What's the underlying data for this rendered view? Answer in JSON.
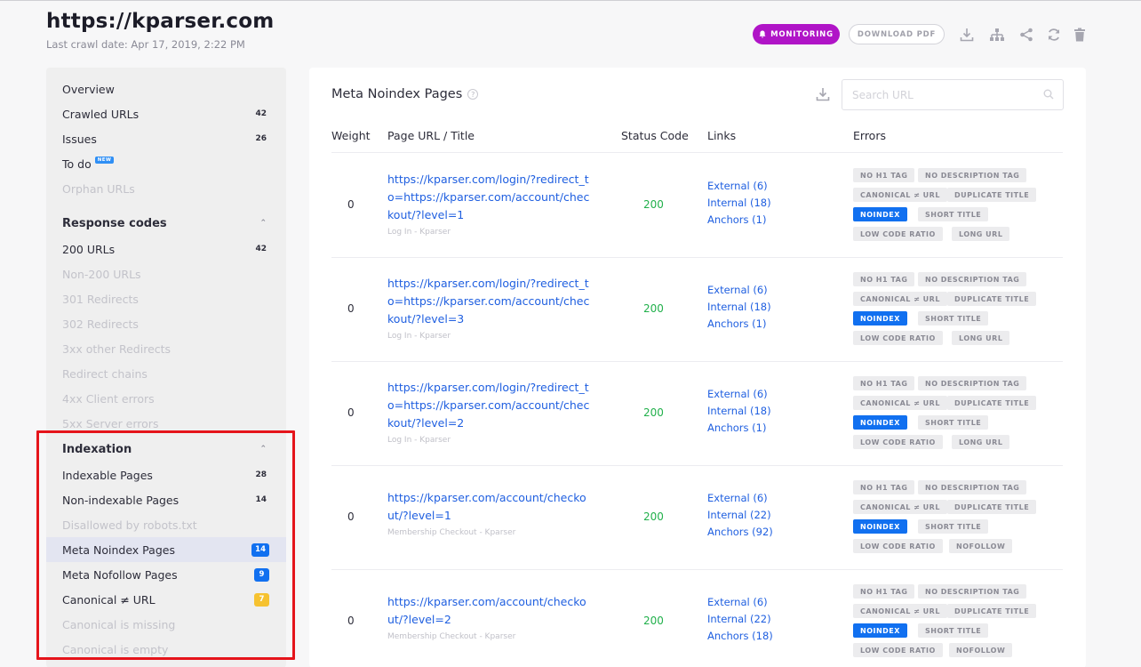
{
  "header": {
    "site_title": "https://kparser.com",
    "crawl_date": "Last crawl date: Apr 17, 2019, 2:22 PM",
    "monitoring_label": "MONITORING",
    "download_pdf_label": "DOWNLOAD PDF",
    "icons": [
      "download-icon",
      "sitemap-icon",
      "share-icon",
      "refresh-icon",
      "trash-icon"
    ]
  },
  "sidebar": {
    "top_items": [
      {
        "label": "Overview",
        "count": ""
      },
      {
        "label": "Crawled URLs",
        "count": "42"
      },
      {
        "label": "Issues",
        "count": "26"
      },
      {
        "label": "To do",
        "count": "",
        "badge": "NEW"
      },
      {
        "label": "Orphan URLs",
        "count": ""
      }
    ],
    "response_codes": {
      "header": "Response codes",
      "items": [
        {
          "label": "200 URLs",
          "count": "42"
        },
        {
          "label": "Non-200 URLs",
          "count": ""
        },
        {
          "label": "301 Redirects",
          "count": ""
        },
        {
          "label": "302 Redirects",
          "count": ""
        },
        {
          "label": "3xx other Redirects",
          "count": ""
        },
        {
          "label": "Redirect chains",
          "count": ""
        },
        {
          "label": "4xx Client errors",
          "count": ""
        },
        {
          "label": "5xx Server errors",
          "count": ""
        }
      ]
    },
    "indexation": {
      "header": "Indexation",
      "items": [
        {
          "label": "Indexable Pages",
          "count": "28"
        },
        {
          "label": "Non-indexable Pages",
          "count": "14"
        },
        {
          "label": "Disallowed by robots.txt",
          "count": ""
        },
        {
          "label": "Meta Noindex Pages",
          "count": "14"
        },
        {
          "label": "Meta Nofollow Pages",
          "count": "9"
        },
        {
          "label": "Canonical ≠ URL",
          "count": "7"
        },
        {
          "label": "Canonical is missing",
          "count": ""
        },
        {
          "label": "Canonical is empty",
          "count": ""
        }
      ]
    }
  },
  "colors": {
    "monitoring": "#b014c7",
    "link": "#1f5fe0",
    "status_ok": "#21b04b",
    "badge_blue": "#1170f0",
    "badge_yellow": "#f6c230",
    "highlight": "#e5141b"
  },
  "main": {
    "title": "Meta Noindex Pages",
    "search_placeholder": "Search URL",
    "columns": [
      "Weight",
      "Page URL / Title",
      "Status Code",
      "Links",
      "Errors"
    ],
    "rows": [
      {
        "weight": "0",
        "url": "https://kparser.com/login/?redirect_to=https://kparser.com/account/checkout/?level=1",
        "title": "Log In - Kparser",
        "status": "200",
        "links": [
          "External (6)",
          "Internal (18)",
          "Anchors (1)"
        ],
        "errors": [
          "NO H1 TAG",
          "NO DESCRIPTION TAG",
          "CANONICAL ≠ URL",
          "DUPLICATE TITLE",
          "NOINDEX",
          "SHORT TITLE",
          "LOW CODE RATIO",
          "LONG URL"
        ]
      },
      {
        "weight": "0",
        "url": "https://kparser.com/login/?redirect_to=https://kparser.com/account/checkout/?level=3",
        "title": "Log In - Kparser",
        "status": "200",
        "links": [
          "External (6)",
          "Internal (18)",
          "Anchors (1)"
        ],
        "errors": [
          "NO H1 TAG",
          "NO DESCRIPTION TAG",
          "CANONICAL ≠ URL",
          "DUPLICATE TITLE",
          "NOINDEX",
          "SHORT TITLE",
          "LOW CODE RATIO",
          "LONG URL"
        ]
      },
      {
        "weight": "0",
        "url": "https://kparser.com/login/?redirect_to=https://kparser.com/account/checkout/?level=2",
        "title": "Log In - Kparser",
        "status": "200",
        "links": [
          "External (6)",
          "Internal (18)",
          "Anchors (1)"
        ],
        "errors": [
          "NO H1 TAG",
          "NO DESCRIPTION TAG",
          "CANONICAL ≠ URL",
          "DUPLICATE TITLE",
          "NOINDEX",
          "SHORT TITLE",
          "LOW CODE RATIO",
          "LONG URL"
        ]
      },
      {
        "weight": "0",
        "url": "https://kparser.com/account/checkout/?level=1",
        "title": "Membership Checkout - Kparser",
        "status": "200",
        "links": [
          "External (6)",
          "Internal (22)",
          "Anchors (92)"
        ],
        "errors": [
          "NO H1 TAG",
          "NO DESCRIPTION TAG",
          "CANONICAL ≠ URL",
          "DUPLICATE TITLE",
          "NOINDEX",
          "SHORT TITLE",
          "LOW CODE RATIO",
          "NOFOLLOW"
        ]
      },
      {
        "weight": "0",
        "url": "https://kparser.com/account/checkout/?level=2",
        "title": "Membership Checkout - Kparser",
        "status": "200",
        "links": [
          "External (6)",
          "Internal (22)",
          "Anchors (18)"
        ],
        "errors": [
          "NO H1 TAG",
          "NO DESCRIPTION TAG",
          "CANONICAL ≠ URL",
          "DUPLICATE TITLE",
          "NOINDEX",
          "SHORT TITLE",
          "LOW CODE RATIO",
          "NOFOLLOW"
        ]
      }
    ]
  }
}
